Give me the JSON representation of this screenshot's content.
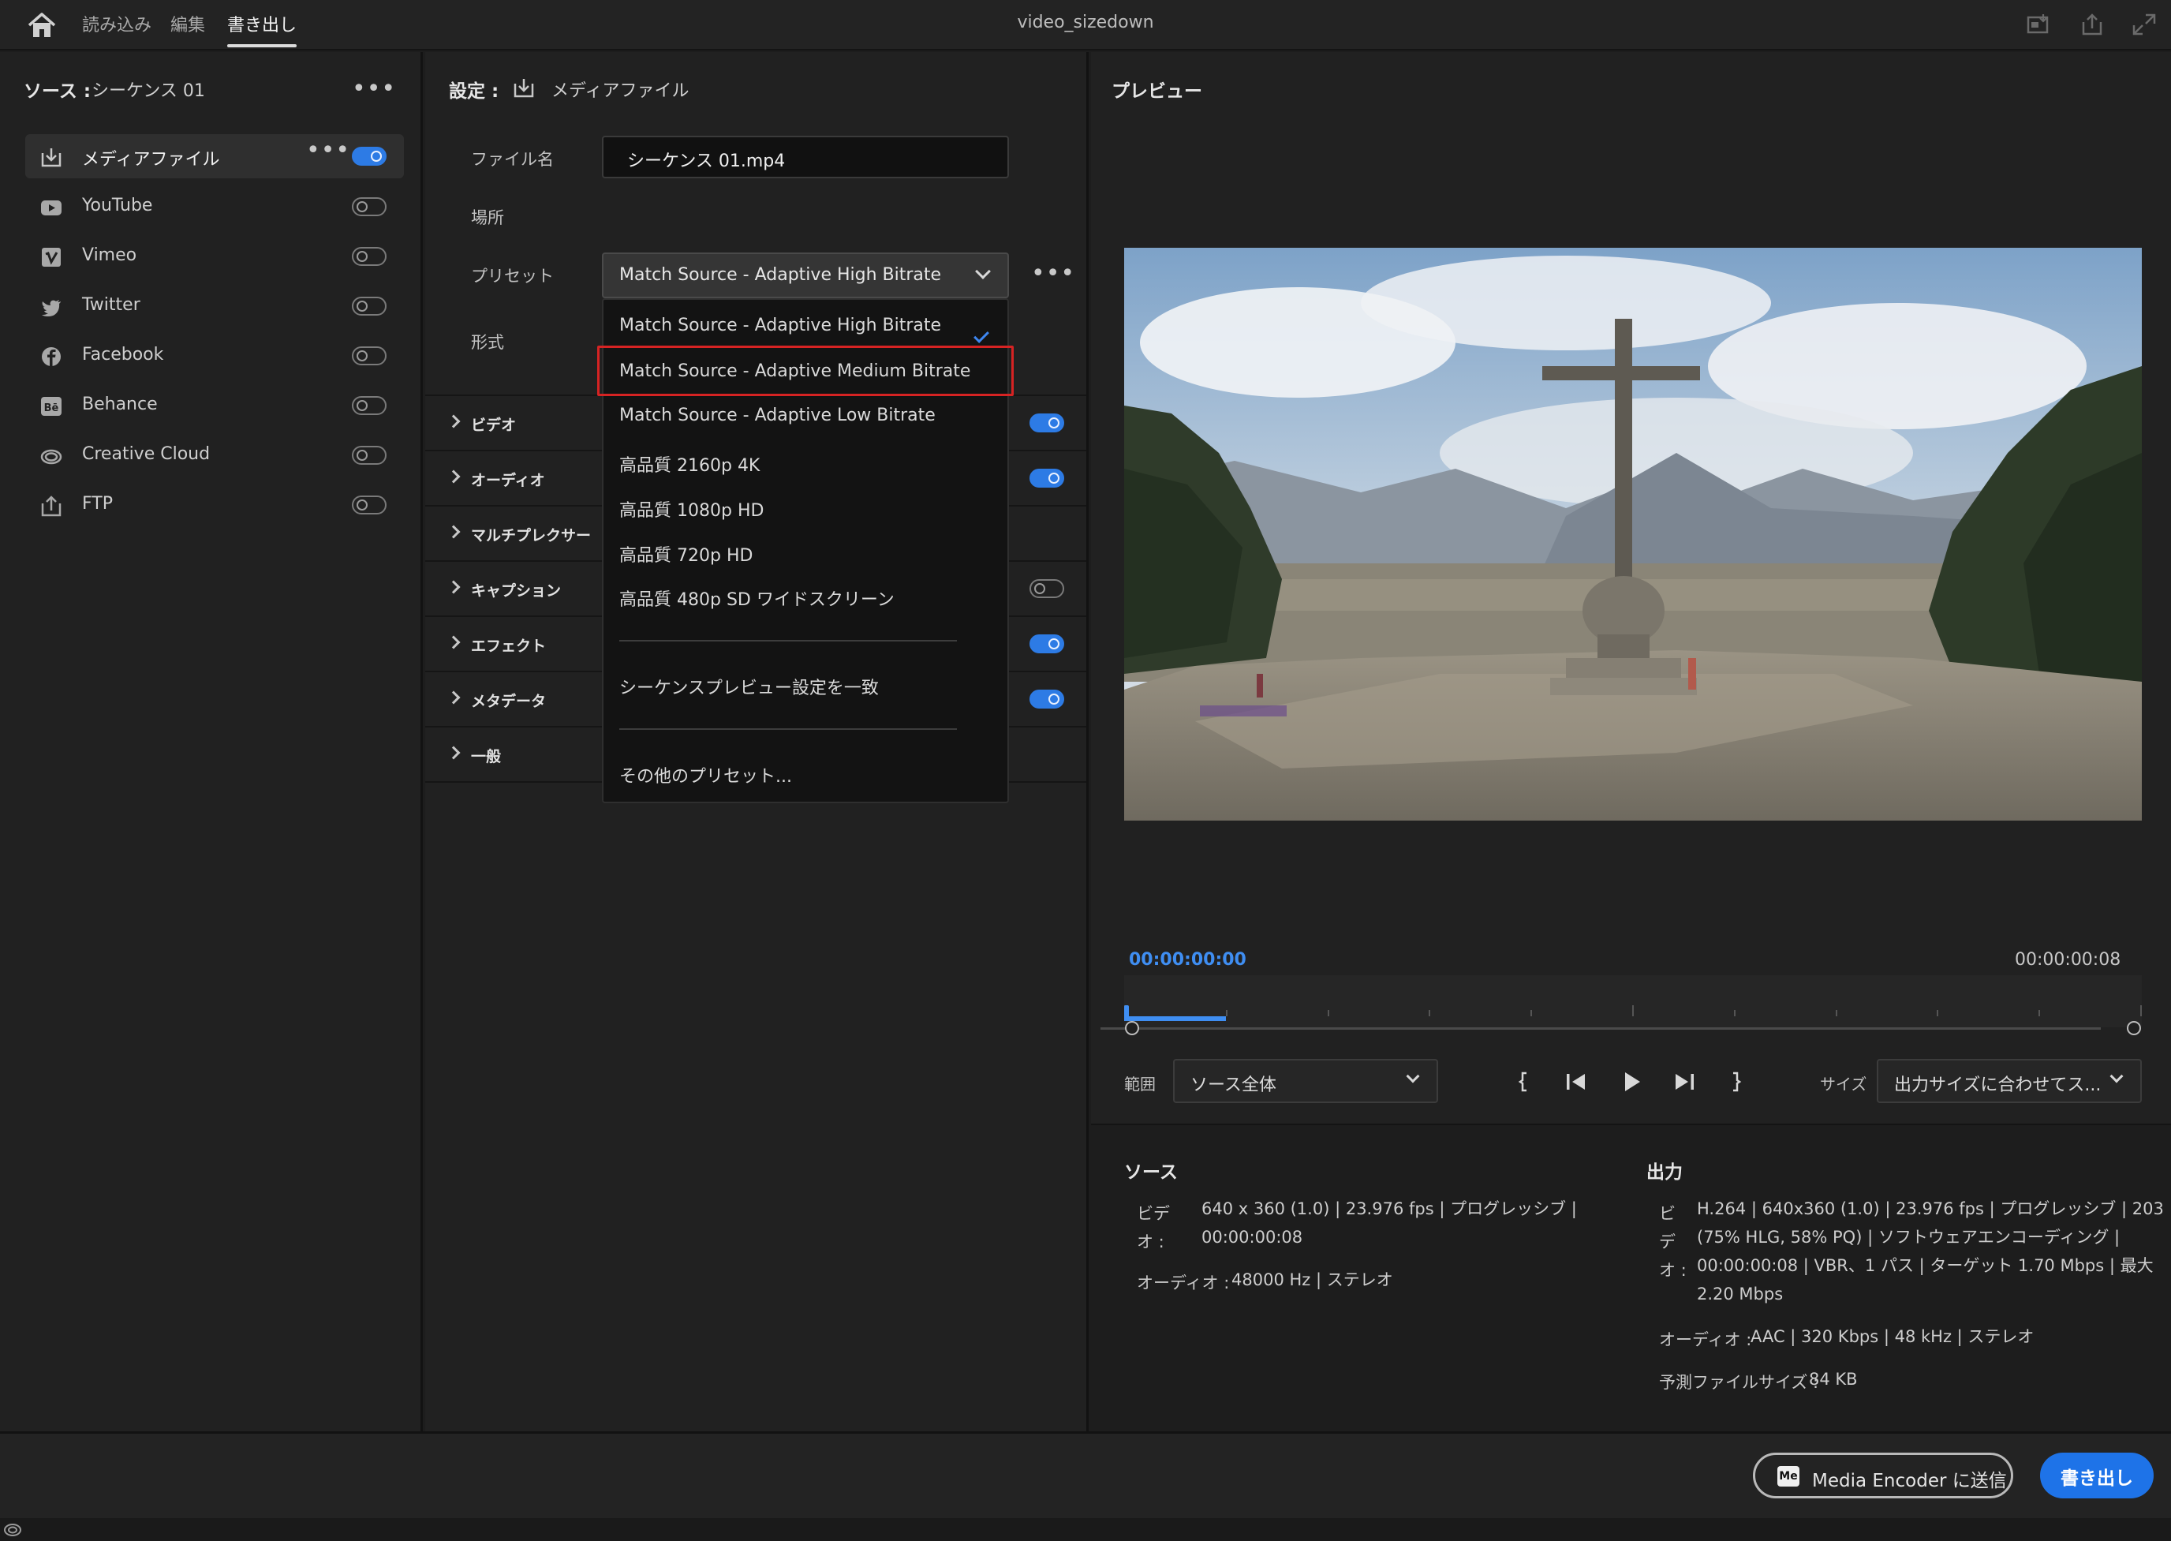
{
  "topbar": {
    "tabs": [
      {
        "label": "読み込み"
      },
      {
        "label": "編集"
      },
      {
        "label": "書き出し"
      }
    ],
    "active_tab": "書き出し",
    "window_title": "video_sizedown",
    "icons": [
      "home-icon",
      "quick-export-icon",
      "share-icon",
      "fullscreen-icon"
    ]
  },
  "source": {
    "label": "ソース :",
    "sequence_name": "シーケンス 01",
    "destinations": [
      {
        "label": "メディアファイル",
        "icon": "media-file-icon",
        "enabled": true
      },
      {
        "label": "YouTube",
        "icon": "youtube-icon",
        "enabled": false
      },
      {
        "label": "Vimeo",
        "icon": "vimeo-icon",
        "enabled": false
      },
      {
        "label": "Twitter",
        "icon": "twitter-icon",
        "enabled": false
      },
      {
        "label": "Facebook",
        "icon": "facebook-icon",
        "enabled": false
      },
      {
        "label": "Behance",
        "icon": "behance-icon",
        "enabled": false
      },
      {
        "label": "Creative Cloud",
        "icon": "creative-cloud-icon",
        "enabled": false
      },
      {
        "label": "FTP",
        "icon": "ftp-icon",
        "enabled": false
      }
    ]
  },
  "settings": {
    "label": "設定 :",
    "target": "メディアファイル",
    "filename_label": "ファイル名",
    "filename_value": "シーケンス 01.mp4",
    "location_label": "場所",
    "preset_label": "プリセット",
    "preset_value": "Match Source - Adaptive High Bitrate",
    "format_label": "形式",
    "sections": [
      {
        "label": "ビデオ",
        "toggle": true
      },
      {
        "label": "オーディオ",
        "toggle": true
      },
      {
        "label": "マルチプレクサー",
        "toggle": null
      },
      {
        "label": "キャプション",
        "toggle": false
      },
      {
        "label": "エフェクト",
        "toggle": true
      },
      {
        "label": "メタデータ",
        "toggle": true
      },
      {
        "label": "一般",
        "toggle": null
      }
    ],
    "preset_menu": {
      "items": [
        "Match Source - Adaptive High Bitrate",
        "Match Source - Adaptive Medium Bitrate",
        "Match Source - Adaptive Low Bitrate",
        "高品質 2160p 4K",
        "高品質 1080p HD",
        "高品質 720p HD",
        "高品質 480p SD ワイドスクリーン"
      ],
      "selected": "Match Source - Adaptive High Bitrate",
      "highlighted": "Match Source - Adaptive Medium Bitrate",
      "match_sequence": "シーケンスプレビュー設定を一致",
      "more_presets": "その他のプリセット..."
    }
  },
  "preview": {
    "title": "プレビュー",
    "timecode_start": "00:00:00:00",
    "timecode_end": "00:00:00:08",
    "playhead_progress": 0.1,
    "range_label": "範囲",
    "range_value": "ソース全体",
    "size_label": "サイズ",
    "size_value": "出力サイズに合わせてス..."
  },
  "info": {
    "source_title": "ソース",
    "source_video_key": "ビデ\nオ :",
    "source_video_line1": "640 x 360 (1.0) | 23.976 fps | プログレッシブ |",
    "source_video_line2": "00:00:00:08",
    "source_audio_key": "オーディオ :",
    "source_audio_value": "48000 Hz | ステレオ",
    "output_title": "出力",
    "output_video_key": "ビ\nデ\nオ :",
    "output_video_line1": "H.264 | 640x360 (1.0) | 23.976 fps | プログレッシブ | 203",
    "output_video_line2": "(75% HLG, 58% PQ) | ソフトウェアエンコーディング |",
    "output_video_line3": "00:00:00:08 | VBR、1 パス | ターゲット 1.70 Mbps | 最大",
    "output_video_line4": "2.20 Mbps",
    "output_audio_key": "オーディオ :",
    "output_audio_value": "AAC | 320 Kbps | 48 kHz | ステレオ",
    "filesize_key": "予測ファイルサイズ :",
    "filesize_value": "84 KB"
  },
  "footer": {
    "media_encoder_icon": "Me",
    "media_encoder_label": "Media Encoder に送信",
    "export_label": "書き出し"
  },
  "colors": {
    "accent": "#1e73e8",
    "timecode": "#3f8ef2",
    "highlight_box": "#d62323"
  }
}
